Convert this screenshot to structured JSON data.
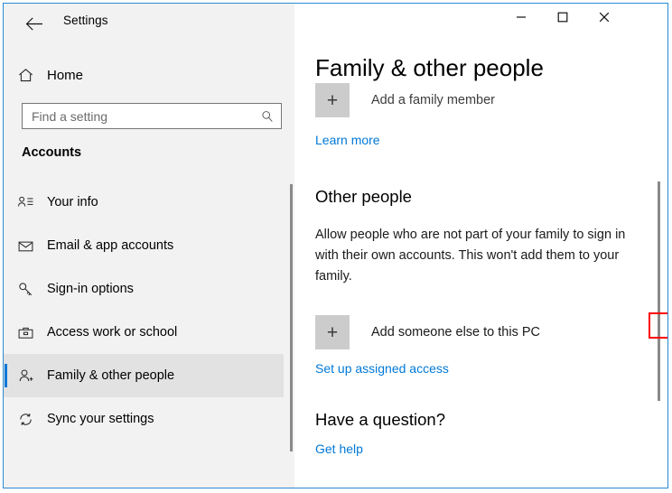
{
  "window": {
    "app_title": "Settings",
    "back_icon": "back-arrow-icon",
    "minimize_icon": "minimize-icon",
    "maximize_icon": "maximize-icon",
    "close_icon": "close-icon",
    "border_color": "#2a8ad4"
  },
  "sidebar": {
    "home_label": "Home",
    "home_icon": "home-icon",
    "search": {
      "placeholder": "Find a setting",
      "value": "",
      "icon": "search-icon"
    },
    "category": "Accounts",
    "items": [
      {
        "label": "Your info",
        "icon": "person-details-icon",
        "selected": false
      },
      {
        "label": "Email & app accounts",
        "icon": "envelope-icon",
        "selected": false
      },
      {
        "label": "Sign-in options",
        "icon": "key-icon",
        "selected": false
      },
      {
        "label": "Access work or school",
        "icon": "briefcase-icon",
        "selected": false
      },
      {
        "label": "Family & other people",
        "icon": "person-add-icon",
        "selected": true
      },
      {
        "label": "Sync your settings",
        "icon": "sync-icon",
        "selected": false
      }
    ],
    "accent_color": "#0078d7",
    "background_color": "#f2f2f2"
  },
  "main": {
    "page_title": "Family & other people",
    "family_section": {
      "add_family_member_label": "Add a family member",
      "add_family_member_icon": "plus-tile-icon",
      "learn_more_label": "Learn more"
    },
    "other_people_section": {
      "heading": "Other people",
      "description": "Allow people who are not part of your family to sign in with their own accounts. This won't add them to your family.",
      "add_someone_label": "Add someone else to this PC",
      "add_someone_icon": "plus-tile-icon",
      "assigned_access_label": "Set up assigned access"
    },
    "help_section": {
      "heading": "Have a question?",
      "get_help_label": "Get help"
    },
    "link_color": "#0078d7"
  },
  "annotation": {
    "highlight_target": "Add someone else to this PC",
    "color": "#ff0000"
  }
}
